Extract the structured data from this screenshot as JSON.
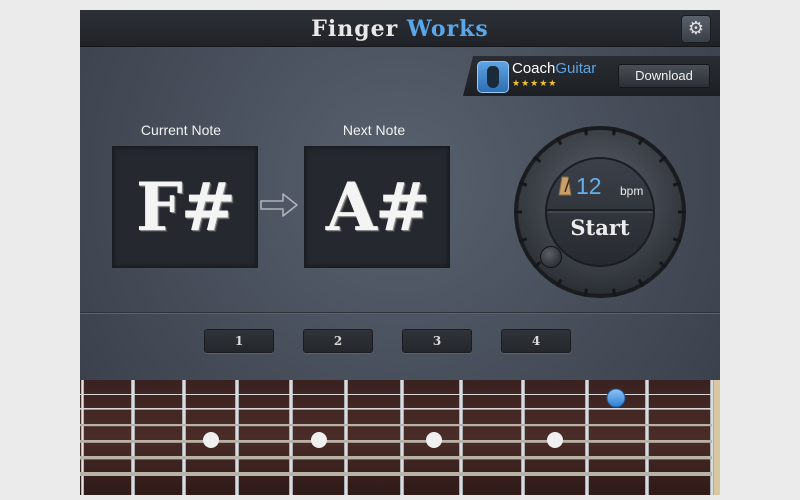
{
  "title": {
    "word1": "Finger",
    "word2": "Works"
  },
  "icons": {
    "settings": "gear-icon",
    "promo": "guitar-app-icon",
    "arrow": "right-arrow-icon",
    "metronome": "metronome-icon"
  },
  "promo": {
    "name_part1": "Coach",
    "name_part2": "Guitar",
    "stars": "★★★★★",
    "download_label": "Download"
  },
  "current_note": {
    "label": "Current Note",
    "value": "F#"
  },
  "next_note": {
    "label": "Next Note",
    "value": "A#"
  },
  "metronome": {
    "bpm": "12",
    "unit": "bpm",
    "start_label": "Start"
  },
  "positions": [
    {
      "label": "1"
    },
    {
      "label": "2"
    },
    {
      "label": "3"
    },
    {
      "label": "4"
    }
  ],
  "fretboard": {
    "active_marker_color": "#4f9be8",
    "inlay_color": "#f0f0f0"
  },
  "colors": {
    "accent": "#5aa6e6",
    "background": "#454c58",
    "panel": "#25292f"
  }
}
